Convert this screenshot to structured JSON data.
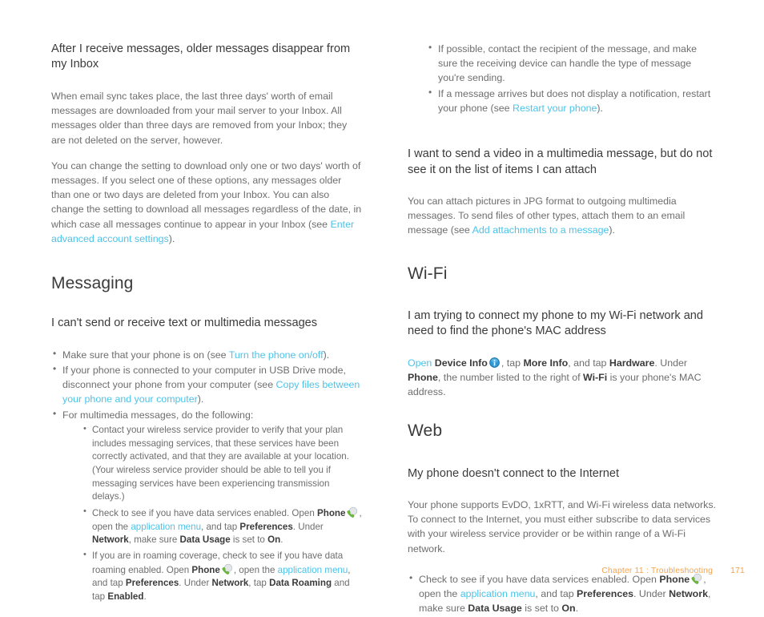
{
  "document": {
    "type": "user-guide-page",
    "colors": {
      "link": "#4cc3e9",
      "body_text": "#6e6e6e",
      "heading_text": "#3b3b3b",
      "footer_text": "#f5a34b",
      "background": "#ffffff",
      "phone_icon": "#79bf3f",
      "info_icon": "#2e97d4"
    }
  },
  "left_column": {
    "q1": {
      "heading": "After I receive messages, older messages disappear from my Inbox",
      "p1": "When email sync takes place, the last three days' worth of email messages are downloaded from your mail server to your Inbox. All messages older than three days are removed from your Inbox; they are not deleted on the server, however.",
      "p2_part1": "You can change the setting to download only one or two days' worth of messages. If you select one of these options, any messages older than one or two days are deleted from your Inbox. You can also change the setting to download all messages regardless of the date, in which case all messages continue to appear in your Inbox (see ",
      "p2_link": "Enter advanced account settings",
      "p2_part2": ")."
    },
    "section_messaging": "Messaging",
    "q2": {
      "heading": "I can't send or receive text or multimedia messages",
      "bullet1_part1": "Make sure that your phone is on (see ",
      "bullet1_link": "Turn the phone on/off",
      "bullet1_part2": ").",
      "bullet2_part1": "If your phone is connected to your computer in USB Drive mode, disconnect your phone from your computer (see ",
      "bullet2_link": "Copy files between your phone and your computer",
      "bullet2_part2": ").",
      "bullet3": "For multimedia messages, do the following:",
      "sub1": "Contact your wireless service provider to verify that your plan includes messaging services, that these services have been correctly activated, and that they are available at your location. (Your wireless service provider should be able to tell you if messaging services have been experiencing transmission delays.)",
      "sub2": {
        "t1": "Check to see if you have data services enabled. Open ",
        "b1": "Phone",
        "icon": "phone-icon",
        "t2": ", open the ",
        "link1": "application menu",
        "t3": ", and tap ",
        "b2": "Preferences",
        "t4": ". Under ",
        "b3": "Network",
        "t5": ", make sure ",
        "b4": "Data Usage",
        "t6": " is set to ",
        "b5": "On",
        "t7": "."
      },
      "sub3": {
        "t1": "If you are in roaming coverage, check to see if you have data roaming enabled. Open ",
        "b1": "Phone",
        "icon": "phone-icon",
        "t2": ", open the ",
        "link1": "application menu",
        "t3": ", and tap ",
        "b2": "Preferences",
        "t4": ". Under ",
        "b3": "Network",
        "t5": ", tap ",
        "b4": "Data Roaming",
        "t6": " and tap ",
        "b5": "Enabled",
        "t7": "."
      }
    }
  },
  "right_column": {
    "top_bullets": {
      "bullet1": "If possible, contact the recipient of the message, and make sure the receiving device can handle the type of message you're sending.",
      "bullet2_part1": "If a message arrives but does not display a notification, restart your phone (see ",
      "bullet2_link": "Restart your phone",
      "bullet2_part2": ")."
    },
    "q3": {
      "heading": "I want to send a video in a multimedia message, but do not see it on the list of items I can attach",
      "p1_part1": "You can attach pictures in JPG format to outgoing multimedia messages. To send files of other types, attach them to an email message (see ",
      "p1_link": "Add attachments to a message",
      "p1_part2": ")."
    },
    "section_wifi": "Wi-Fi",
    "q4": {
      "heading": "I am trying to connect my phone to my Wi-Fi network and need to find the phone's MAC address",
      "p1": {
        "link1": "Open",
        "t1": " ",
        "b1": "Device Info",
        "icon": "info-icon",
        "t2": ", tap ",
        "b2": "More Info",
        "t3": ", and tap ",
        "b3": "Hardware",
        "t4": ". Under ",
        "b4": "Phone",
        "t5": ", the number listed to the right of ",
        "b5": "Wi-Fi",
        "t6": " is your phone's MAC address."
      }
    },
    "section_web": "Web",
    "q5": {
      "heading": "My phone doesn't connect to the Internet",
      "p1": "Your phone supports EvDO, 1xRTT, and Wi-Fi wireless data networks. To connect to the Internet, you must either subscribe to data services with your wireless service provider or be within range of a Wi-Fi network.",
      "bullet1": {
        "t1": "Check to see if you have data services enabled. Open ",
        "b1": "Phone",
        "icon": "phone-icon",
        "t2": ", open the ",
        "link1": "application menu",
        "t3": ", and tap ",
        "b2": "Preferences",
        "t4": ". Under ",
        "b3": "Network",
        "t5": ", make sure ",
        "b4": "Data Usage",
        "t6": " is set to ",
        "b5": "On",
        "t7": "."
      }
    }
  },
  "footer": {
    "chapter": "Chapter 11  :  Troubleshooting",
    "page_number": "171"
  }
}
